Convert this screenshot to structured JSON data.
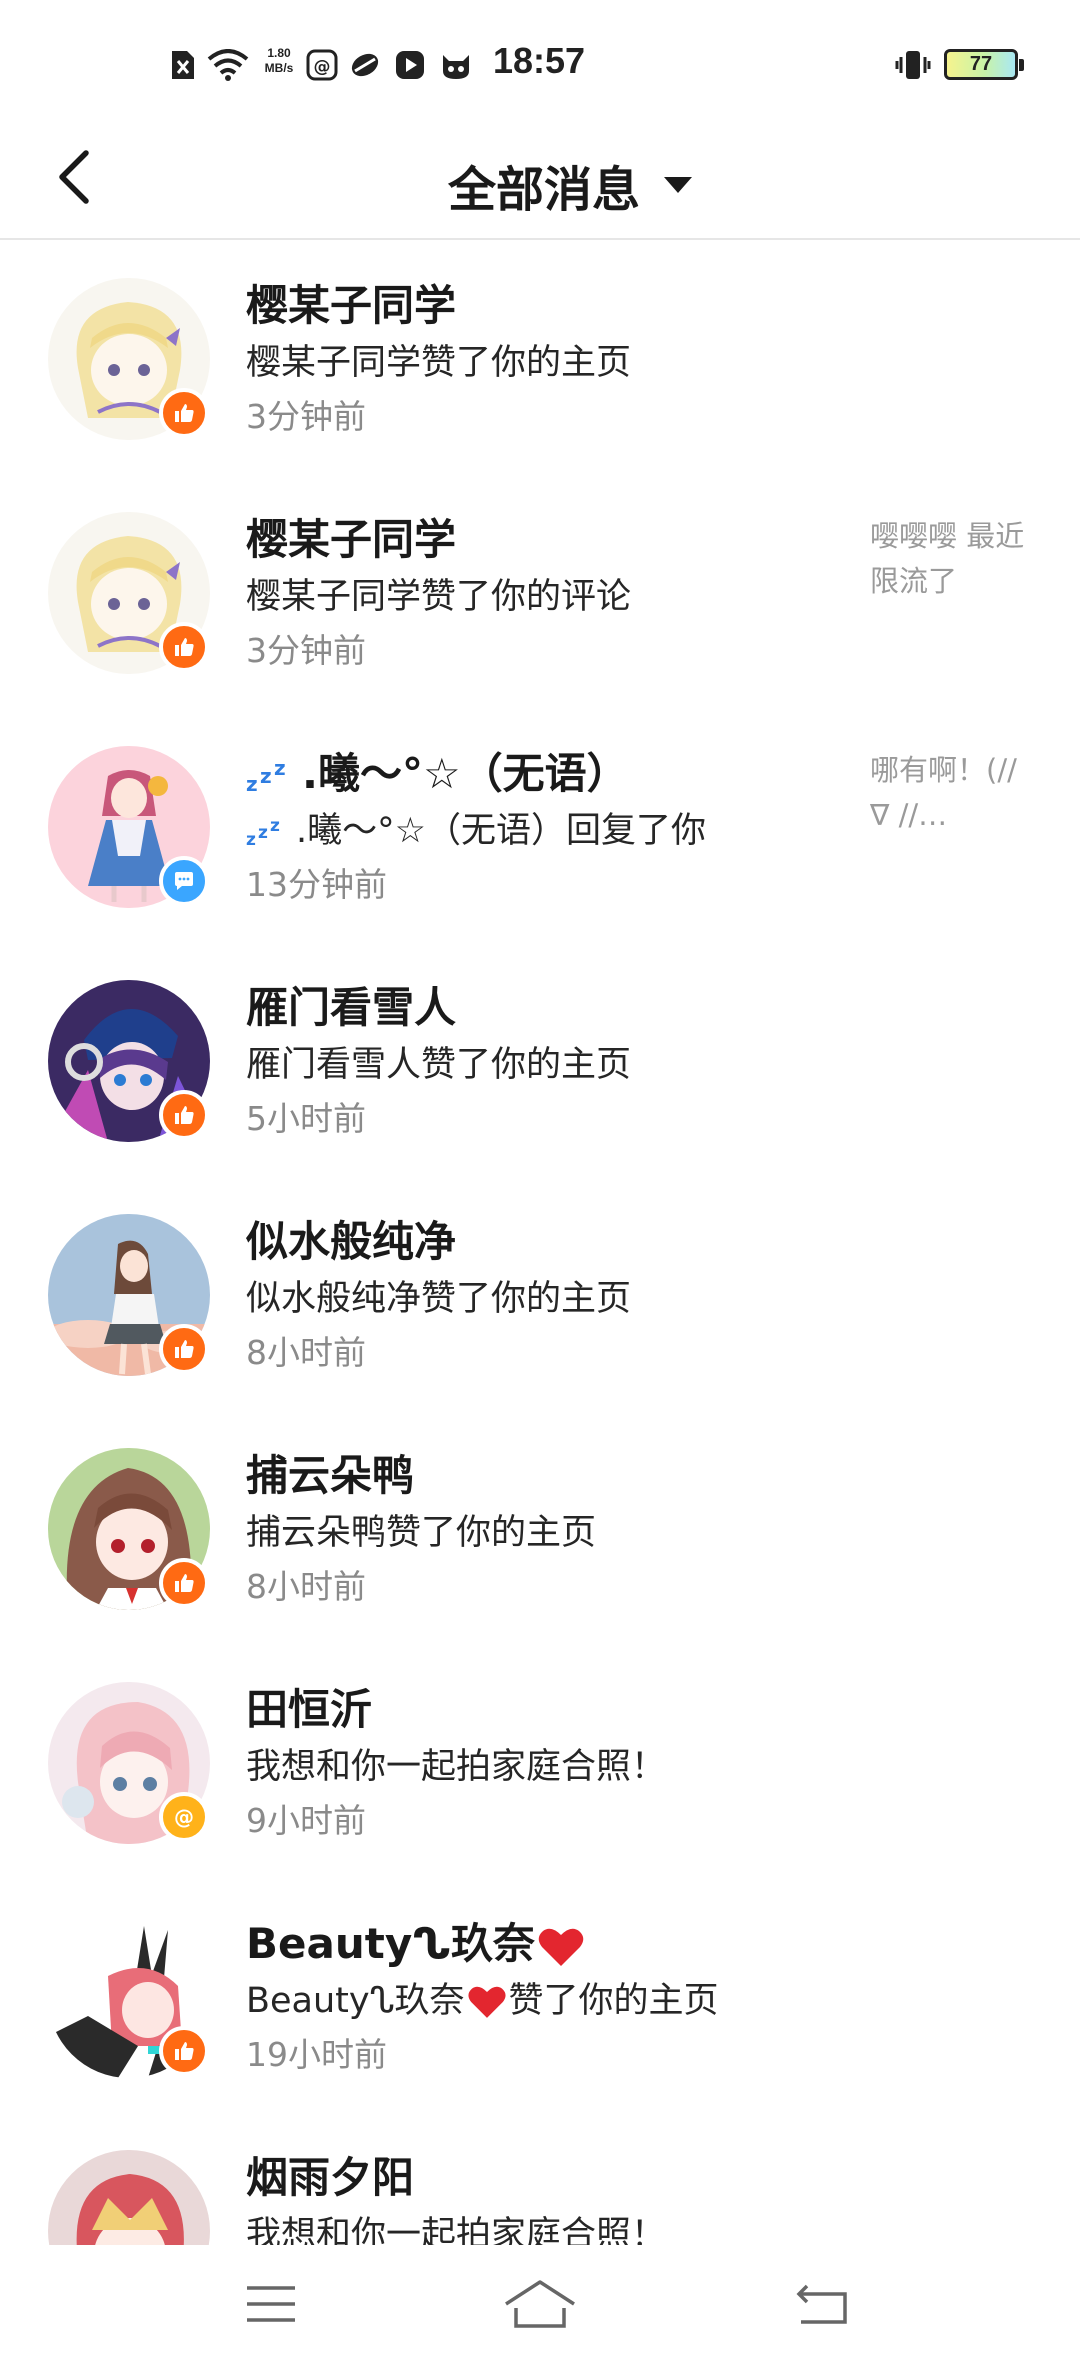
{
  "status_bar": {
    "time": "18:57",
    "net_speed_value": "1.80",
    "net_speed_unit": "MB/s",
    "battery_level": "77",
    "icons": [
      "sim-off-icon",
      "wifi-icon",
      "net-speed",
      "app-notification-icon",
      "app-notification-icon",
      "video-app-icon",
      "cat-app-icon",
      "vibrate-icon",
      "battery-icon"
    ]
  },
  "header": {
    "title": "全部消息",
    "icons": [
      "back-arrow-icon",
      "dropdown-caret-icon"
    ]
  },
  "messages": [
    {
      "name": "樱某子同学",
      "content": "樱某子同学赞了你的主页",
      "time": "3分钟前",
      "preview": "",
      "badge": "like",
      "avatar_color": "#f3e9c6"
    },
    {
      "name": "樱某子同学",
      "content": "樱某子同学赞了你的评论",
      "time": "3分钟前",
      "preview": "嘤嘤嘤 最近限流了",
      "badge": "like",
      "avatar_color": "#f3e9c6"
    },
    {
      "name": ".曦～°☆（无语）",
      "content": ".曦～°☆（无语）回复了你",
      "time": "13分钟前",
      "preview": "哪有啊！(// ∇ //…",
      "badge": "comment",
      "avatar_color": "#fcd3dc"
    },
    {
      "name": "雁门看雪人",
      "content": "雁门看雪人赞了你的主页",
      "time": "5小时前",
      "preview": "",
      "badge": "like",
      "avatar_color": "#3b2a63"
    },
    {
      "name": "似水般纯净",
      "content": "似水般纯净赞了你的主页",
      "time": "8小时前",
      "preview": "",
      "badge": "like",
      "avatar_color": "#a9c3dc"
    },
    {
      "name": "捕云朵鸭",
      "content": "捕云朵鸭赞了你的主页",
      "time": "8小时前",
      "preview": "",
      "badge": "like",
      "avatar_color": "#8a5a4a"
    },
    {
      "name": "田恒沂",
      "content": "我想和你一起拍家庭合照！",
      "time": "9小时前",
      "preview": "",
      "badge": "mention",
      "avatar_color": "#f4d2d6"
    },
    {
      "name": "Beautyᔐ玖奈",
      "content": "Beautyᔐ玖奈",
      "content_suffix": "赞了你的主页",
      "time": "19小时前",
      "preview": "",
      "badge": "like",
      "avatar_color": "#2a2a2a"
    },
    {
      "name": "烟雨夕阳",
      "content": "我想和你一起拍家庭合照！",
      "time": "",
      "preview": "",
      "badge": "",
      "avatar_color": "#e9d8d8"
    }
  ],
  "colors": {
    "like_badge": "#ff6a13",
    "comment_badge": "#3aa6ff",
    "mention_badge": "#ffb21a",
    "heart": "#e3262f"
  },
  "nav_bar": {
    "icons": [
      "menu-icon",
      "home-icon",
      "back-icon"
    ]
  }
}
